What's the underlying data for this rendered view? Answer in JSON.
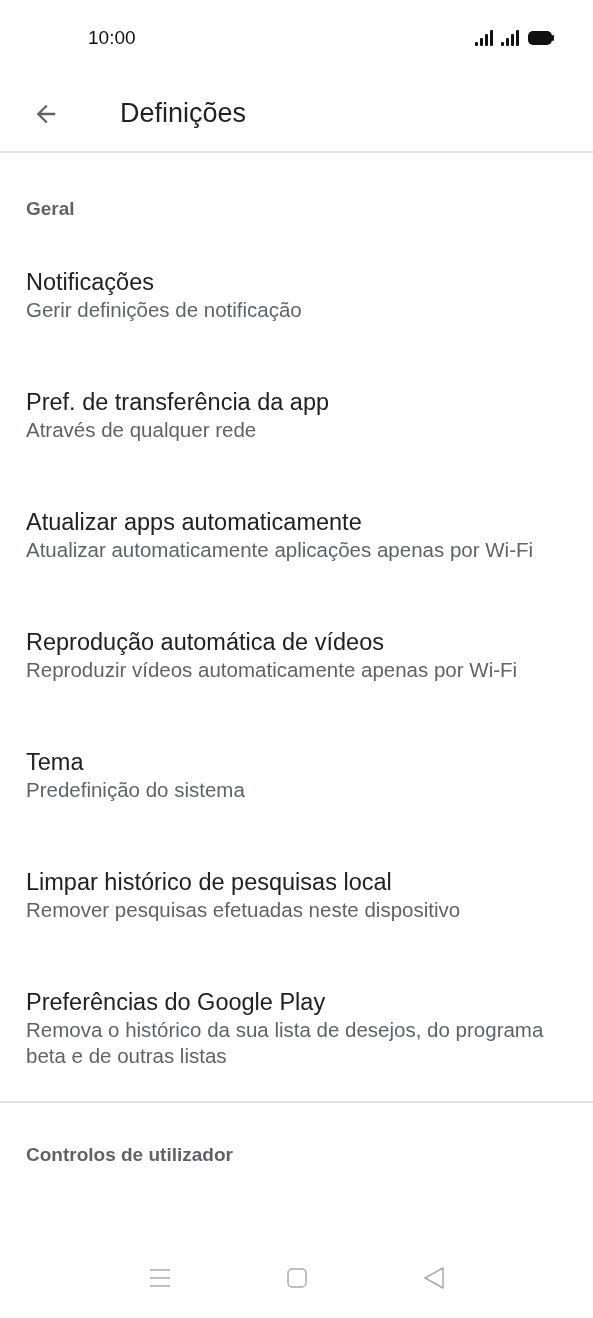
{
  "status_bar": {
    "time": "10:00"
  },
  "app_bar": {
    "title": "Definições"
  },
  "sections": [
    {
      "header": "Geral",
      "items": [
        {
          "title": "Notificações",
          "subtitle": "Gerir definições de notificação"
        },
        {
          "title": "Pref. de transferência da app",
          "subtitle": "Através de qualquer rede"
        },
        {
          "title": "Atualizar apps automaticamente",
          "subtitle": "Atualizar automaticamente aplicações apenas por Wi-Fi"
        },
        {
          "title": "Reprodução automática de vídeos",
          "subtitle": "Reproduzir vídeos automaticamente apenas por Wi-Fi"
        },
        {
          "title": "Tema",
          "subtitle": "Predefinição do sistema"
        },
        {
          "title": "Limpar histórico de pesquisas local",
          "subtitle": "Remover pesquisas efetuadas neste dispositivo"
        },
        {
          "title": "Preferências do Google Play",
          "subtitle": "Remova o histórico da sua lista de desejos, do programa beta e de outras listas"
        }
      ]
    },
    {
      "header": "Controlos de utilizador"
    }
  ]
}
